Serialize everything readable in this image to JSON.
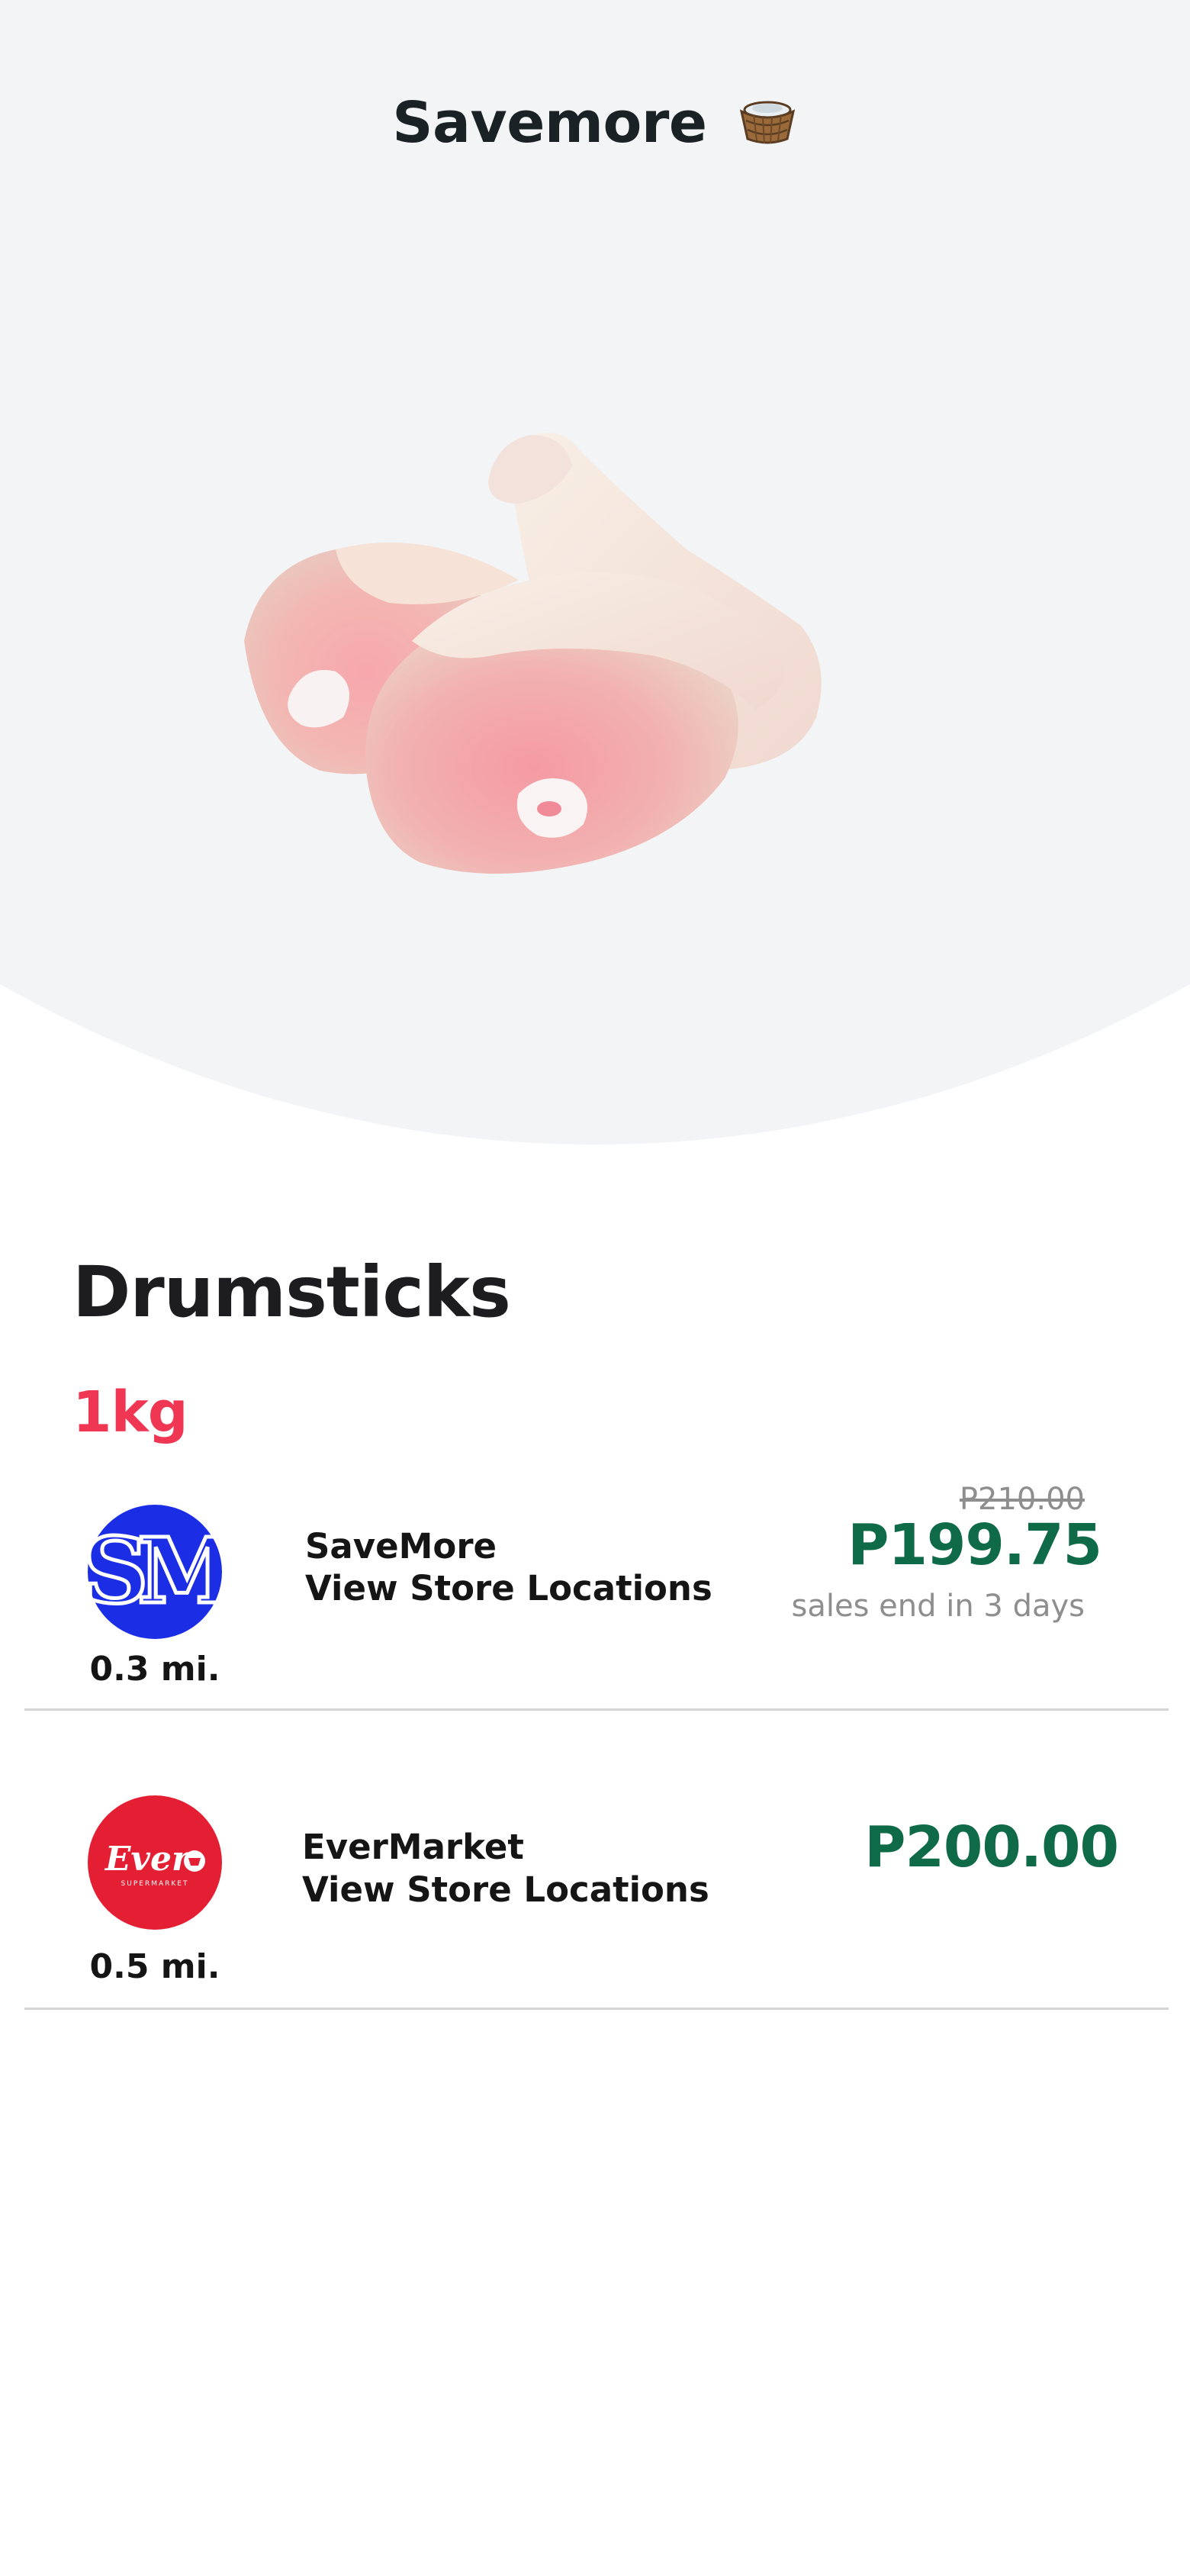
{
  "header": {
    "title": "Savemore",
    "icon": "basket-icon"
  },
  "product": {
    "image": "chicken-drumsticks-image",
    "name": "Drumsticks",
    "size": "1kg"
  },
  "offers": [
    {
      "logo": "sm-logo",
      "logo_color": "#1b2ee6",
      "distance": "0.3 mi.",
      "store_name": "SaveMore",
      "link_label": "View Store Locations",
      "old_price": "P210.00",
      "price": "P199.75",
      "sale_note": "sales end in 3 days"
    },
    {
      "logo": "ever-logo",
      "logo_color": "#e51f33",
      "distance": "0.5 mi.",
      "store_name": "EverMarket",
      "link_label": "View Store Locations",
      "price": "P200.00"
    }
  ],
  "colors": {
    "price": "#0e6a47",
    "size": "#ef3652",
    "hero_bg": "#f3f4f6"
  }
}
